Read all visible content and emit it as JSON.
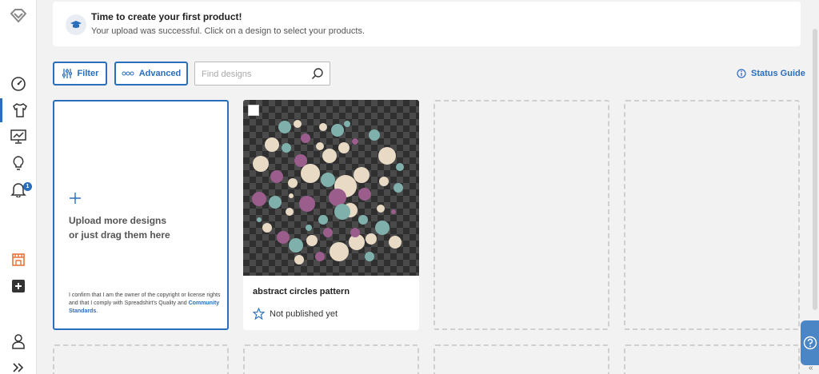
{
  "banner": {
    "title": "Time to create your first product!",
    "subtitle": "Your upload was successful. Click on a design to select your products."
  },
  "toolbar": {
    "filter_label": "Filter",
    "advanced_label": "Advanced",
    "search_placeholder": "Find designs",
    "status_guide_label": "Status Guide"
  },
  "sidebar": {
    "items": [
      {
        "icon": "logo-icon"
      },
      {
        "icon": "dashboard-icon"
      },
      {
        "icon": "tshirt-icon",
        "active": true
      },
      {
        "icon": "analytics-icon"
      },
      {
        "icon": "lightbulb-icon"
      },
      {
        "icon": "bell-icon",
        "badge": "1"
      },
      {
        "icon": "shop-icon"
      },
      {
        "icon": "add-icon"
      },
      {
        "icon": "user-icon"
      },
      {
        "icon": "expand-icon"
      }
    ]
  },
  "upload": {
    "line1": "Upload more designs",
    "line2": "or just drag them here",
    "legal_text": "I confirm that I am the owner of the copyright or license rights and that I comply with Spreadshirt's Quality and",
    "legal_link": "Community Standards",
    "legal_end": "."
  },
  "designs": [
    {
      "title": "abstract circles pattern",
      "status": "Not published yet"
    }
  ],
  "colors": {
    "accent": "#2a6ebb",
    "orange": "#e8743b",
    "circle_cream": "#e8dac5",
    "circle_teal": "#7fb0ac",
    "circle_mauve": "#9a5d8c"
  }
}
